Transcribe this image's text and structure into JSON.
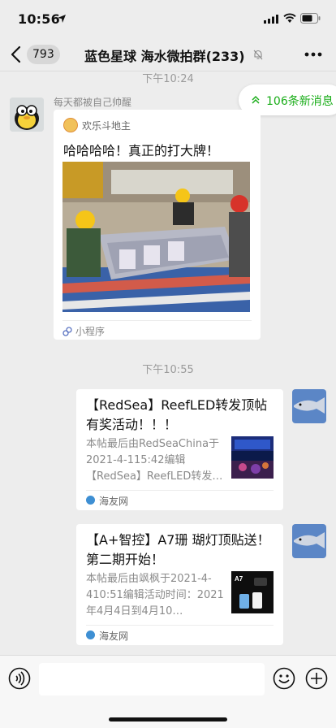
{
  "status": {
    "time": "10:56"
  },
  "nav": {
    "unread_count": "793",
    "title": "蓝色星球 海水微拍群(233)"
  },
  "timestamps": {
    "first": "下午10:24",
    "second": "下午10:55"
  },
  "new_messages": {
    "label": "106条新消息"
  },
  "message1": {
    "sender": "每天都被自己帅醒",
    "source_name": "欢乐斗地主",
    "title": "哈哈哈哈！真正的打大牌！",
    "footer": "小程序"
  },
  "link_cards": [
    {
      "title": "【RedSea】ReefLED转发顶帖有奖活动！！！",
      "description": "本帖最后由RedSeaChina于2021-4-115:42编辑【RedSea】ReefLED转发…",
      "source": "海友网"
    },
    {
      "title": "【A+智控】A7珊 瑚灯顶贴送！第二期开始！",
      "description": "本帖最后由飒枫于2021-4-410:51编辑活动时间：2021年4月4日到4月10…",
      "source": "海友网",
      "thumb_text": "A7"
    }
  ],
  "input": {
    "placeholder": ""
  }
}
